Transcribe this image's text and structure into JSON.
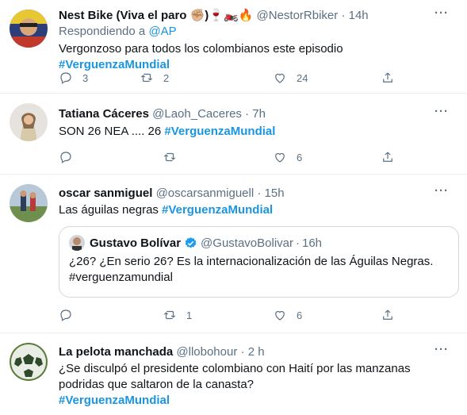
{
  "tweets": [
    {
      "name": "Nest Bike (Viva el paro ✊🏼)🍷🏍️🔥",
      "handle": "@NestorRbiker",
      "sep": "·",
      "time": "14h",
      "replying_prefix": "Respondiendo a ",
      "replying_to": "@AP",
      "text": "Vergonzoso para todos los colombianos este episodio ",
      "hashtag": "#VerguenzaMundial",
      "replies": "3",
      "retweets": "2",
      "likes": "24"
    },
    {
      "name": "Tatiana Cáceres",
      "handle": "@Laoh_Caceres",
      "sep": "·",
      "time": "7h",
      "text": "SON 26 NEA .... 26  ",
      "hashtag": "#VerguenzaMundial",
      "replies": "",
      "retweets": "",
      "likes": "6"
    },
    {
      "name": "oscar sanmiguel",
      "handle": "@oscarsanmiguell",
      "sep": "·",
      "time": "15h",
      "text": "Las águilas negras ",
      "hashtag": "#VerguenzaMundial",
      "quote": {
        "name": "Gustavo Bolívar",
        "handle": "@GustavoBolivar",
        "sep": "·",
        "time": "16h",
        "text": "¿26? ¿En serio 26? Es la internacionalización de las Águilas Negras. #verguenzamundial"
      },
      "replies": "",
      "retweets": "1",
      "likes": "6"
    },
    {
      "name": "La pelota manchada",
      "handle": "@llobohour",
      "sep": "·",
      "time": "2 h",
      "text": "¿Se disculpó el presidente colombiano con Haití por las manzanas podridas que saltaron de la canasta?",
      "hashtag": "#VerguenzaMundial"
    }
  ],
  "more_label": "···",
  "colors": {
    "accent": "#1b95e0",
    "secondary_text": "#5b7083",
    "divider": "#ebeef0"
  },
  "icons": [
    "reply-icon",
    "retweet-icon",
    "like-icon",
    "share-icon",
    "more-icon",
    "verified-icon"
  ]
}
